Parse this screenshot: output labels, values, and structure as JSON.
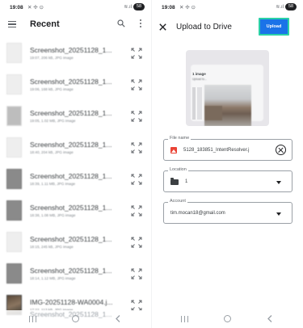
{
  "status_bar": {
    "time": "19:08",
    "battery": "58"
  },
  "left": {
    "title": "Recent",
    "files": [
      {
        "name": "Screenshot_20251128_1...",
        "meta": "19:07, 206 kB, JPG image",
        "thumb": "light"
      },
      {
        "name": "Screenshot_20251128_1...",
        "meta": "19:06, 168 kB, JPG image",
        "thumb": "light"
      },
      {
        "name": "Screenshot_20251128_1...",
        "meta": "19:05, 1.02 MB, JPG image",
        "thumb": "mid"
      },
      {
        "name": "Screenshot_20251128_1...",
        "meta": "18:40, 204 kB, JPG image",
        "thumb": "light"
      },
      {
        "name": "Screenshot_20251128_1...",
        "meta": "18:39, 1.11 MB, JPG image",
        "thumb": "dark"
      },
      {
        "name": "Screenshot_20251128_1...",
        "meta": "18:38, 1.08 MB, JPG image",
        "thumb": "dark"
      },
      {
        "name": "Screenshot_20251128_1...",
        "meta": "18:15, 245 kB, JPG image",
        "thumb": "light"
      },
      {
        "name": "Screenshot_20251128_1...",
        "meta": "18:14, 1.12 MB, JPG image",
        "thumb": "dark"
      },
      {
        "name": "IMG-20251128-WA0004.j...",
        "meta": "17:22, 113 kB, JPG image",
        "thumb": "photo"
      }
    ],
    "peek_item": "Screenshot_20251128_1..."
  },
  "right": {
    "title": "Upload to Drive",
    "upload_label": "Upload",
    "preview": {
      "label": "1 image",
      "sub": "Upload to..."
    },
    "file_name": {
      "label": "File name",
      "value": "5128_183851_IntentResolver.j"
    },
    "location": {
      "label": "Location",
      "value": "1"
    },
    "account": {
      "label": "Account",
      "value": "tim.mocan18@gmail.com"
    }
  },
  "colors": {
    "accent": "#1a73e8",
    "upload_border": "#2bd0a7",
    "image_icon": "#ea4335"
  }
}
